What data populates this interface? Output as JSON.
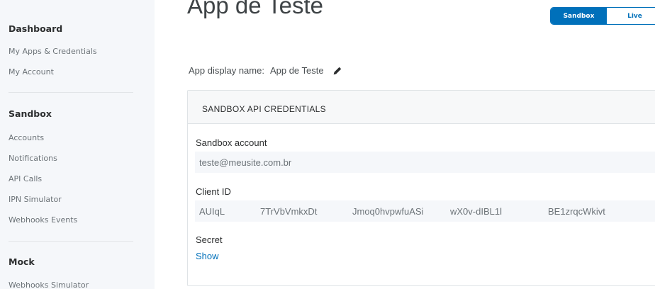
{
  "sidebar": {
    "sections": [
      {
        "heading": "Dashboard",
        "items": [
          "My Apps & Credentials",
          "My Account"
        ]
      },
      {
        "heading": "Sandbox",
        "items": [
          "Accounts",
          "Notifications",
          "API Calls",
          "IPN Simulator",
          "Webhooks Events"
        ]
      },
      {
        "heading": "Mock",
        "items": [
          "Webhooks Simulator"
        ]
      }
    ]
  },
  "header": {
    "title": "App de Teste",
    "toggle": {
      "sandbox_label": "Sandbox",
      "live_label": "Live",
      "active": "Sandbox"
    }
  },
  "app_display": {
    "label": "App display name:",
    "value": "App de Teste"
  },
  "credentials": {
    "title": "SANDBOX API CREDENTIALS",
    "sandbox_account_label": "Sandbox account",
    "sandbox_account_value": "teste@meusite.com.br",
    "client_id_label": "Client ID",
    "client_id_parts": [
      "AUIqL",
      "7TrVbVmkxDt",
      "Jmoq0hvpwfuASi",
      "wX0v-dIBL1l",
      "BE1zrqcWkivt"
    ],
    "secret_label": "Secret",
    "show_label": "Show"
  },
  "colors": {
    "accent": "#0070ba",
    "sidebar_bg": "#f5f7fa"
  }
}
